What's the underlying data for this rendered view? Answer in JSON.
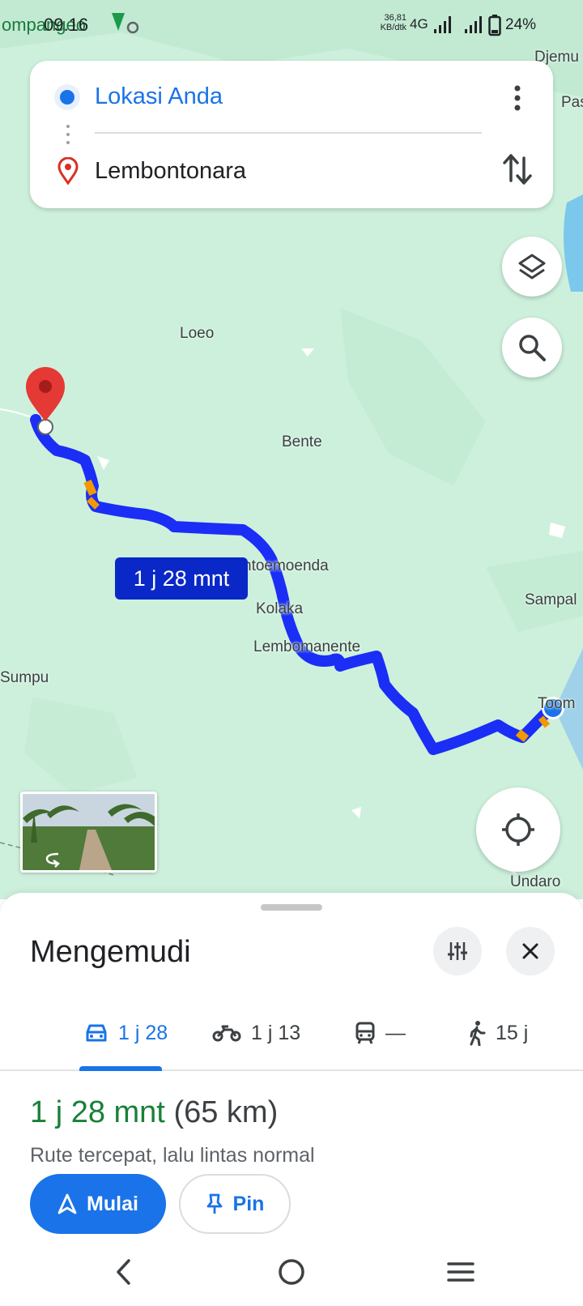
{
  "status_bar": {
    "map_top_name": "ompangeo",
    "time": "09.16",
    "speed_value": "36,81",
    "speed_unit": "KB/dtk",
    "network": "4G",
    "battery": "24%"
  },
  "directions": {
    "origin": "Lokasi Anda",
    "destination": "Lembontonara",
    "more_icon": "more-vert-icon",
    "swap_icon": "swap-vertical-icon"
  },
  "map": {
    "places": {
      "djemu": "Djemu",
      "pas": "Pas",
      "loeo": "Loeo",
      "bente": "Bente",
      "ntoemoenda": "ntoemoenda",
      "kolaka": "Kolaka",
      "lembomanente": "Lembomanente",
      "sampal": "Sampal",
      "sumpu": "Sumpu",
      "toom": "Toom",
      "undaro": "Undaro"
    },
    "route_label": "1 j 28 mnt",
    "route_color": "#1a2ef5",
    "traffic_color": "#f29900"
  },
  "sheet": {
    "title": "Mengemudi",
    "modes": [
      {
        "icon": "car-icon",
        "label": "1 j 28",
        "active": true
      },
      {
        "icon": "motorcycle-icon",
        "label": "1 j 13",
        "active": false
      },
      {
        "icon": "transit-icon",
        "label": "—",
        "active": false
      },
      {
        "icon": "walk-icon",
        "label": "15 j",
        "active": false
      }
    ],
    "duration": "1 j 28 mnt",
    "distance": "(65 km)",
    "description": "Rute tercepat, lalu lintas normal",
    "start_label": "Mulai",
    "pin_label": "Pin"
  },
  "colors": {
    "accent": "#1a73e8",
    "duration_green": "#188038",
    "map_bg": "#cdf0dc"
  }
}
